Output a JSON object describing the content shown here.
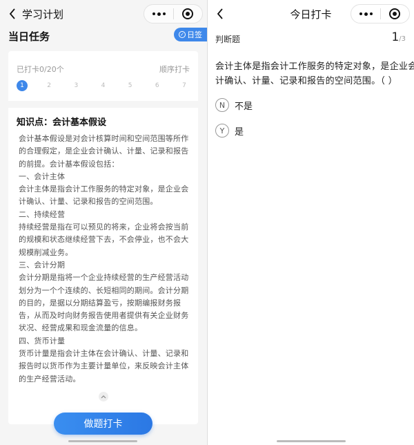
{
  "left": {
    "nav_title": "学习计划",
    "section_title": "当日任务",
    "sign_label": "日签",
    "progress_label": "已打卡0/20个",
    "mode_label": "顺序打卡",
    "steps": [
      "1",
      "2",
      "3",
      "4",
      "5",
      "6",
      "7"
    ],
    "active_step": "1",
    "knowledge_title": "知识点：会计基本假设",
    "knowledge_lines": [
      "会计基本假设是对会计核算时间和空间范围等所作",
      "的合理假定，是企业会计确认、计量、记录和报告",
      "的前提。会计基本假设包括：",
      "一、会计主体",
      "会计主体是指会计工作服务的特定对象，是企业会",
      "计确认、计量、记录和报告的空间范围。",
      "二、持续经营",
      "持续经营是指在可以预见的将来，企业将会按当前",
      "的规模和状态继续经营下去，不会停业，也不会大",
      "规模削减业务。",
      "三、会计分期",
      "会计分期是指将一个企业持续经营的生产经营活动",
      "划分为一个个连续的、长短相同的期间。会计分期",
      "的目的，是据以分期结算盈亏，按期编报财务报",
      "告，从而及时向财务报告使用者提供有关企业财务",
      "状况、经营成果和现金流量的信息。",
      "四、货币计量",
      "货币计量是指会计主体在会计确认、计量、记录和",
      "报告时以货币作为主要计量单位，来反映会计主体",
      "的生产经营活动。"
    ],
    "action_button": "做题打卡"
  },
  "right": {
    "nav_title": "今日打卡",
    "question_type": "判断题",
    "current": "1",
    "total": "/3",
    "question_lines": [
      "会计主体是指会计工作服务的特定对象，是企业会",
      "计确认、计量、记录和报告的空间范围。（   ）"
    ],
    "options": [
      {
        "letter": "N",
        "text": "不是"
      },
      {
        "letter": "Y",
        "text": "是"
      }
    ]
  },
  "colors": {
    "accent": "#3e88ea",
    "background": "#f5f5f5"
  },
  "icons": [
    "back-arrow-icon",
    "more-dots-icon",
    "close-capsule-icon",
    "check-circle-icon",
    "chevron-up-icon"
  ]
}
